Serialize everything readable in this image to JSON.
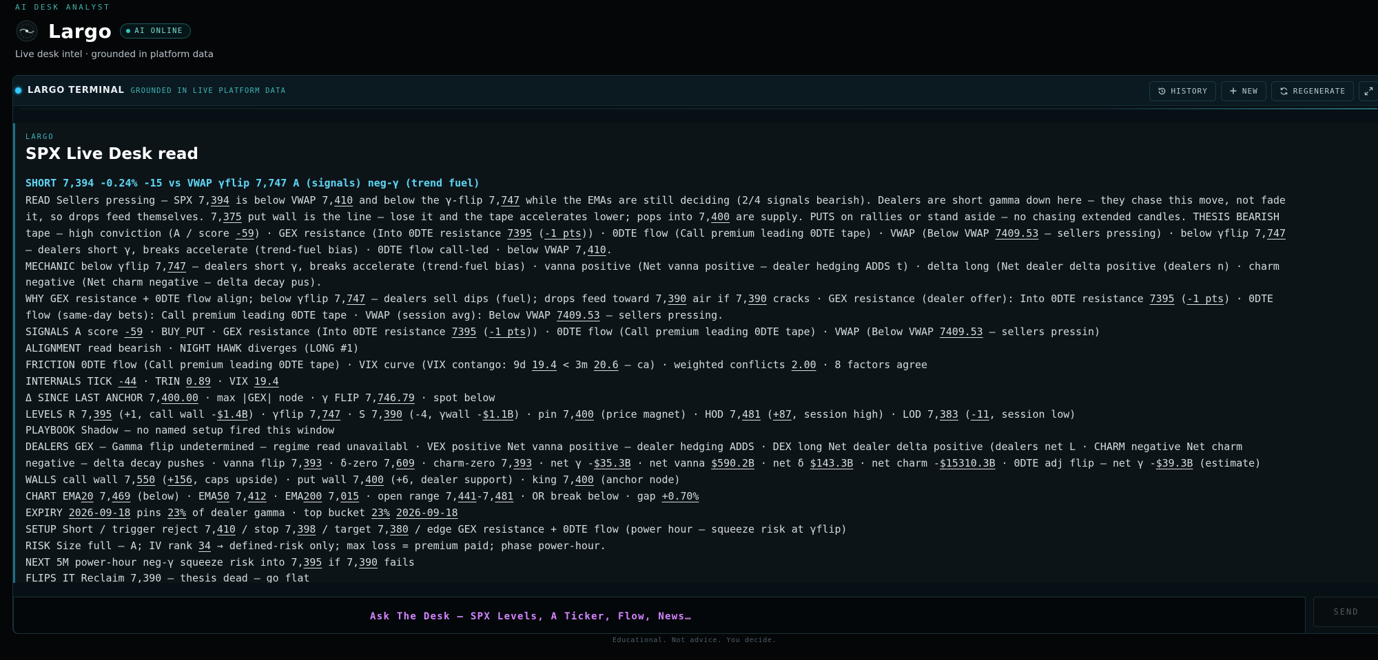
{
  "header": {
    "eyebrow": "AI DESK ANALYST",
    "app_name": "Largo",
    "status_badge": "AI ONLINE",
    "subtitle": "Live desk intel · grounded in platform data"
  },
  "terminal": {
    "title": "LARGO TERMINAL",
    "subtitle": "GROUNDED IN LIVE PLATFORM DATA",
    "buttons": {
      "history": "HISTORY",
      "new": "NEW",
      "regenerate": "REGENERATE"
    }
  },
  "message": {
    "author": "LARGO",
    "title": "SPX Live Desk read",
    "headline": "SHORT 7,394 -0.24% -15 vs VWAP γflip 7,747 A (signals) neg-γ (trend fuel)",
    "lines": [
      "READ Sellers pressing — SPX 7,[394] is below VWAP 7,[410] and below the γ-flip 7,[747] while the EMAs are still deciding (2/4 signals bearish). Dealers are short gamma down here — they chase this move, not fade",
      "it, so drops feed themselves. 7,[375] put wall is the line — lose it and the tape accelerates lower; pops into 7,[400] are supply. PUTS on rallies or stand aside — no chasing extended candles. THESIS BEARISH",
      "tape — high conviction (A / score [-59]) · GEX resistance (Into 0DTE resistance [7395] ([-1 pts])) · 0DTE flow (Call premium leading 0DTE tape) · VWAP (Below VWAP [7409.53] — sellers pressing) · below γflip 7,[747]",
      "— dealers short γ, breaks accelerate (trend-fuel bias) · 0DTE flow call-led · below VWAP 7,[410].",
      "MECHANIC below γflip 7,[747] — dealers short γ, breaks accelerate (trend-fuel bias) · vanna positive (Net vanna positive — dealer hedging ADDS t) · delta long (Net dealer delta positive (dealers n) · charm",
      "negative (Net charm negative — delta decay pus).",
      "WHY GEX resistance + 0DTE flow align; below γflip 7,[747] — dealers sell dips (fuel); drops feed toward 7,[390] air if 7,[390] cracks · GEX resistance (dealer offer): Into 0DTE resistance [7395] ([-1 pts]) · 0DTE",
      "flow (same-day bets): Call premium leading 0DTE tape · VWAP (session avg): Below VWAP [7409.53] — sellers pressing.",
      "SIGNALS A score [-59] · BUY_PUT · GEX resistance (Into 0DTE resistance [7395] ([-1 pts])) · 0DTE flow (Call premium leading 0DTE tape) · VWAP (Below VWAP [7409.53] — sellers pressin)",
      "ALIGNMENT read bearish · NIGHT HAWK diverges (LONG #1)",
      "FRICTION 0DTE flow (Call premium leading 0DTE tape) · VIX curve (VIX contango: 9d [19.4] < 3m [20.6] — ca) · weighted conflicts [2.00] · 8 factors agree",
      "INTERNALS TICK [-44] · TRIN [0.89] · VIX [19.4]",
      "Δ SINCE LAST ANCHOR 7,[400.00] · max |GEX| node · γ FLIP 7,[746.79] · spot below",
      "LEVELS R 7,[395] (+1, call wall -[$1.4B]) · γflip 7,[747] · S 7,[390] (-4, γwall -[$1.1B]) · pin 7,[400] (price magnet) · HOD 7,[481] ([+87], session high) · LOD 7,[383] ([-11], session low)",
      "PLAYBOOK Shadow — no named setup fired this window",
      "DEALERS GEX — Gamma flip undetermined — regime read unavailabl · VEX positive Net vanna positive — dealer hedging ADDS · DEX long Net dealer delta positive (dealers net L · CHARM negative Net charm",
      "negative — delta decay pushes · vanna flip 7,[393] · δ-zero 7,[609] · charm-zero 7,[393] · net γ -[$35.3B] · net vanna [$590.2B] · net δ [$143.3B] · net charm -[$15310.3B] · 0DTE adj flip — net γ -[$39.3B] (estimate)",
      "WALLS call wall 7,[550] ([+156], caps upside) · put wall 7,[400] (+6, dealer support) · king 7,[400] (anchor node)",
      "CHART EMA[20] 7,[469] (below) · EMA[50] 7,[412] · EMA[200] 7,[015] · open range 7,[441]-7,[481] · OR break below · gap [+0.70%]",
      "EXPIRY [2026-09-18] pins [23%] of dealer gamma · top bucket [23%] [2026-09-18]",
      "SETUP Short / trigger reject 7,[410] / stop 7,[398] / target 7,[380] / edge GEX resistance + 0DTE flow (power hour — squeeze risk at γflip)",
      "RISK Size full — A; IV rank [34] → defined-risk only; max loss = premium paid; phase power-hour.",
      "NEXT 5M power-hour neg-γ squeeze risk into 7,[395] if 7,[390] fails",
      "FLIPS IT Reclaim 7,[390] — thesis dead — go flat"
    ]
  },
  "composer": {
    "placeholder": "Ask The Desk — SPX Levels, A Ticker, Flow, News…",
    "send_label": "SEND"
  },
  "footer": {
    "disclaimer": "Educational. Not advice. You decide."
  },
  "colors": {
    "accent_teal": "#3fb3b5",
    "accent_cyan": "#5fd6f4",
    "placeholder_purple": "#d685ff",
    "background": "#040608"
  }
}
